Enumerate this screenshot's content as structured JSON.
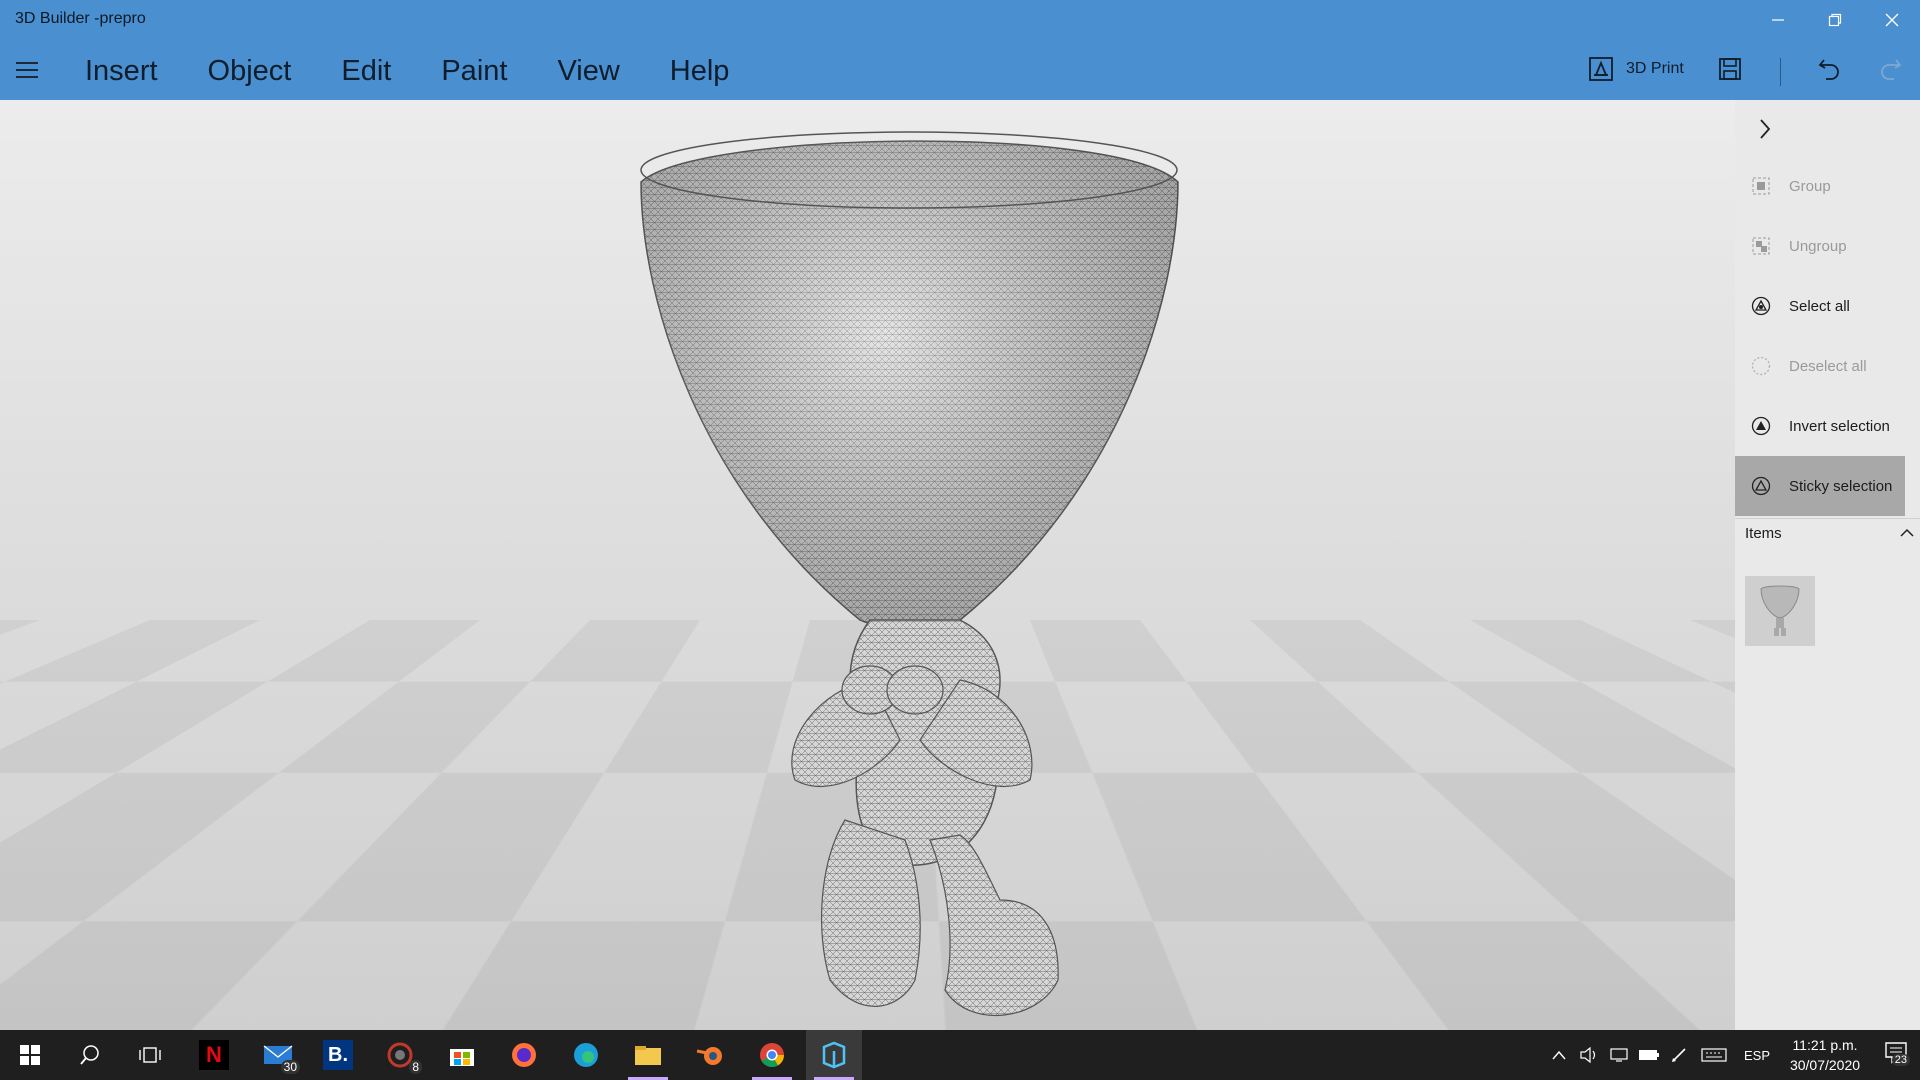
{
  "window": {
    "title": "3D Builder -prepro",
    "controls": [
      "minimize-icon",
      "restore-icon",
      "close-icon"
    ]
  },
  "menu": {
    "items": [
      "Insert",
      "Object",
      "Edit",
      "Paint",
      "View",
      "Help"
    ]
  },
  "toolbar": {
    "print_label": "3D Print",
    "icons": [
      "3d-print-icon",
      "save-icon",
      "undo-icon",
      "redo-icon"
    ]
  },
  "panel": {
    "actions": [
      {
        "label": "Group",
        "icon": "group-icon",
        "enabled": false
      },
      {
        "label": "Ungroup",
        "icon": "ungroup-icon",
        "enabled": false
      },
      {
        "label": "Select all",
        "icon": "select-all-icon",
        "enabled": true
      },
      {
        "label": "Deselect all",
        "icon": "deselect-all-icon",
        "enabled": false
      },
      {
        "label": "Invert selection",
        "icon": "invert-selection-icon",
        "enabled": true
      },
      {
        "label": "Sticky selection",
        "icon": "sticky-selection-icon",
        "enabled": true,
        "active": true
      }
    ],
    "items_title": "Items"
  },
  "taskbar": {
    "apps": [
      {
        "name": "start",
        "icon": "windows-start-icon"
      },
      {
        "name": "search",
        "icon": "search-icon"
      },
      {
        "name": "task-view",
        "icon": "task-view-icon"
      },
      {
        "name": "netflix",
        "icon": "netflix-icon"
      },
      {
        "name": "mail",
        "icon": "mail-icon",
        "badge": "30"
      },
      {
        "name": "booking",
        "icon": "booking-icon"
      },
      {
        "name": "app-8",
        "icon": "app-8-icon",
        "badge": "8"
      },
      {
        "name": "store",
        "icon": "microsoft-store-icon"
      },
      {
        "name": "firefox",
        "icon": "firefox-icon"
      },
      {
        "name": "edge",
        "icon": "edge-icon"
      },
      {
        "name": "file-explorer",
        "icon": "folder-icon"
      },
      {
        "name": "blender",
        "icon": "blender-icon"
      },
      {
        "name": "chrome",
        "icon": "chrome-icon"
      },
      {
        "name": "3d-builder",
        "icon": "3d-builder-icon"
      }
    ],
    "tray": {
      "language": "ESP",
      "time": "11:21 p.m.",
      "date": "30/07/2020",
      "notifications": "23"
    }
  }
}
